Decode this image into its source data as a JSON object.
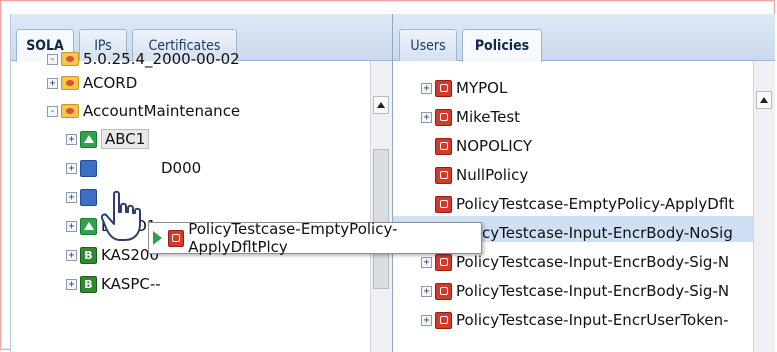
{
  "left_tabs": [
    "SOLA",
    "IPs",
    "Certificates"
  ],
  "right_tabs": [
    "Users",
    "Policies"
  ],
  "left_tree": {
    "nodes": [
      {
        "label": "5.0.25.4_2000-00-02",
        "icon": "folder-icon",
        "expanded": true
      },
      {
        "label": "ACORD",
        "icon": "folder-icon",
        "expanded": false
      },
      {
        "label": "AccountMaintenance",
        "icon": "folder-icon",
        "expanded": true
      },
      {
        "label": "ABC1",
        "icon": "green-service-icon",
        "selected": true
      },
      {
        "label": "D000",
        "icon": "blue-service-icon"
      },
      {
        "label": "",
        "icon": "blue-service-icon"
      },
      {
        "label": "DEMO1",
        "icon": "green-service-icon"
      },
      {
        "label": "KAS200",
        "icon": "b-icon",
        "badge": "B"
      },
      {
        "label": "KASPC--",
        "icon": "b-icon",
        "badge": "B"
      }
    ]
  },
  "right_tree": {
    "nodes": [
      {
        "label": "MYPOL",
        "icon": "policy-icon",
        "expander": true
      },
      {
        "label": "MikeTest",
        "icon": "policy-icon",
        "expander": true
      },
      {
        "label": "NOPOLICY",
        "icon": "policy-icon",
        "expander": false
      },
      {
        "label": "NullPolicy",
        "icon": "policy-icon",
        "expander": false
      },
      {
        "label": "PolicyTestcase-EmptyPolicy-ApplyDflt",
        "icon": "policy-icon",
        "expander": false,
        "highlighted": true
      },
      {
        "label": "PolicyTestcase-Input-EncrBody-NoSig",
        "icon": "policy-icon",
        "expander": true
      },
      {
        "label": "PolicyTestcase-Input-EncrBody-Sig-N",
        "icon": "policy-icon",
        "expander": true
      },
      {
        "label": "PolicyTestcase-Input-EncrBody-Sig-N",
        "icon": "policy-icon",
        "expander": true
      },
      {
        "label": "PolicyTestcase-Input-EncrUserToken-",
        "icon": "policy-icon",
        "expander": true
      }
    ]
  },
  "drag_tooltip": {
    "label": "PolicyTestcase-EmptyPolicy-ApplyDfltPlcy",
    "icon": "policy-icon"
  },
  "cursor": {
    "icon": "hand-pointer-icon"
  },
  "colors": {
    "accent": "#cfe0f4",
    "tab_bg": "#c9d9ec",
    "frame_border": "#f2a6a6"
  }
}
